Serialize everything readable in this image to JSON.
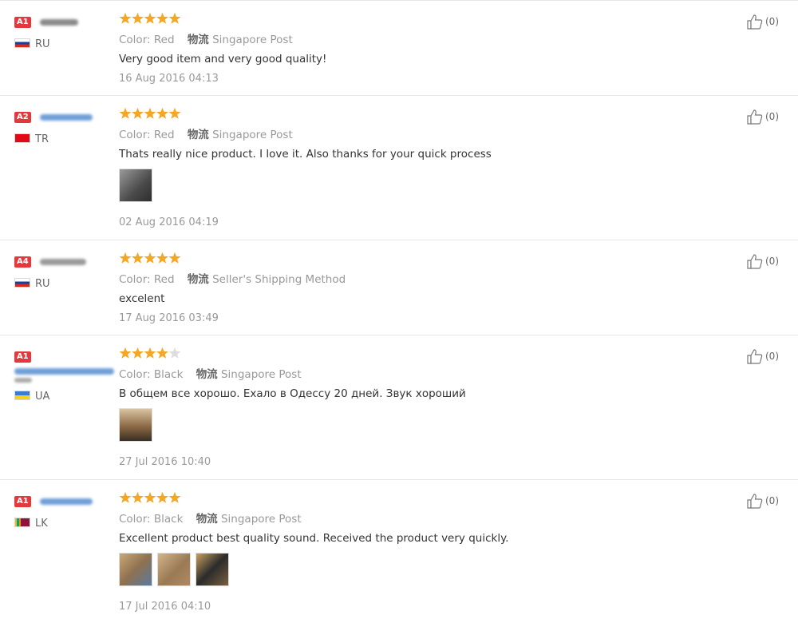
{
  "colors": {
    "star_on": "#f5a623",
    "star_off": "#dddddd",
    "badge": "#e4393c"
  },
  "reviews": [
    {
      "level": "A1",
      "country": "RU",
      "rating": 5,
      "color_label": "Color:",
      "color_value": "Red",
      "ship_label": "物流",
      "ship_value": "Singapore Post",
      "text": "Very good item and very good quality!",
      "date": "16 Aug 2016 04:13",
      "helpful": "(0)",
      "photos": 0
    },
    {
      "level": "A2",
      "country": "TR",
      "rating": 5,
      "color_label": "Color:",
      "color_value": "Red",
      "ship_label": "物流",
      "ship_value": "Singapore Post",
      "text": "Thats really nice product. I love it. Also thanks for your quick process",
      "date": "02 Aug 2016 04:19",
      "helpful": "(0)",
      "photos": 1
    },
    {
      "level": "A4",
      "country": "RU",
      "rating": 5,
      "color_label": "Color:",
      "color_value": "Red",
      "ship_label": "物流",
      "ship_value": "Seller's Shipping Method",
      "text": "excelent",
      "date": "17 Aug 2016 03:49",
      "helpful": "(0)",
      "photos": 0
    },
    {
      "level": "A1",
      "country": "UA",
      "rating": 4,
      "color_label": "Color:",
      "color_value": "Black",
      "ship_label": "物流",
      "ship_value": "Singapore Post",
      "text": "В общем все хорошо. Ехало в Одессу 20 дней. Звук хороший",
      "date": "27 Jul 2016 10:40",
      "helpful": "(0)",
      "photos": 1
    },
    {
      "level": "A1",
      "country": "LK",
      "rating": 5,
      "color_label": "Color:",
      "color_value": "Black",
      "ship_label": "物流",
      "ship_value": "Singapore Post",
      "text": "Excellent product best quality sound. Received the product very quickly.",
      "date": "17 Jul 2016 04:10",
      "helpful": "(0)",
      "photos": 3
    }
  ]
}
